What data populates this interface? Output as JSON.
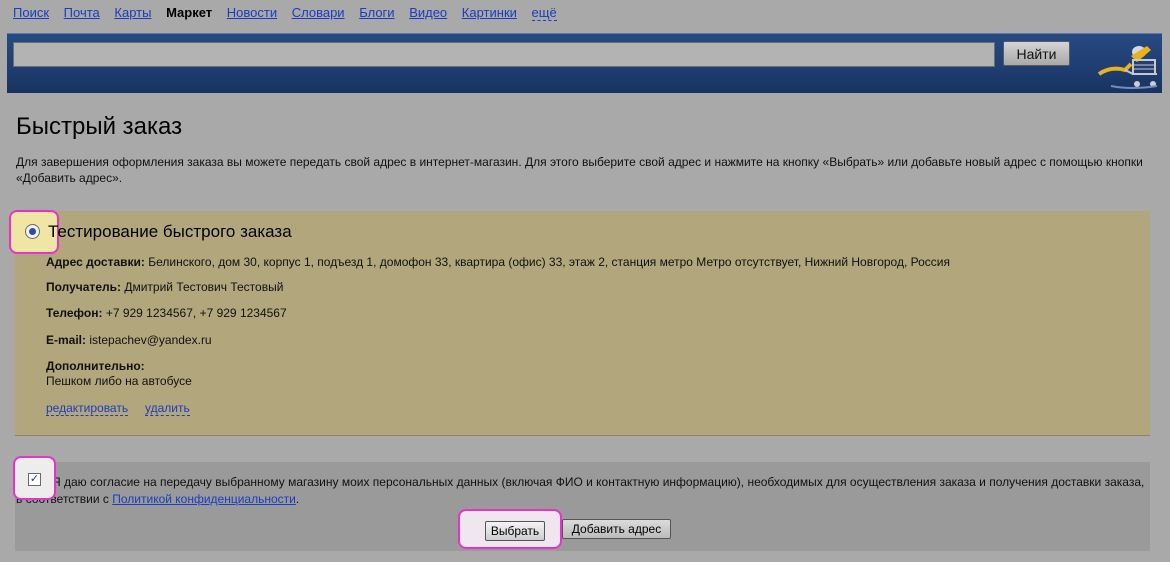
{
  "nav": {
    "items": [
      "Поиск",
      "Почта",
      "Карты",
      "Маркет",
      "Новости",
      "Словари",
      "Блоги",
      "Видео",
      "Картинки",
      "ещё"
    ],
    "active": "Маркет"
  },
  "search": {
    "value": "",
    "button_label": "Найти"
  },
  "page": {
    "title": "Быстрый заказ",
    "intro": "Для завершения оформления заказа вы можете передать свой адрес в интернет-магазин. Для этого выберите свой адрес и нажмите на кнопку «Выбрать» или добавьте новый адрес с помощью кнопки «Добавить адрес»."
  },
  "address": {
    "selected": true,
    "title": "Тестирование быстрого заказа",
    "delivery_label": "Адрес доставки:",
    "delivery_value": "Белинского, дом 30, корпус 1, подъезд 1, домофон 33, квартира (офис) 33, этаж 2, станция метро Метро отсутствует, Нижний Новгород, Россия",
    "recipient_label": "Получатель:",
    "recipient_value": "Дмитрий Тестович Тестовый",
    "phone_label": "Телефон:",
    "phone_value": "+7 929 1234567, +7 929 1234567",
    "email_label": "E-mail:",
    "email_value": "istepachev@yandex.ru",
    "extra_label": "Дополнительно:",
    "extra_value": "Пешком либо на автобусе",
    "edit_link": "редактировать",
    "delete_link": "удалить"
  },
  "consent": {
    "checked": true,
    "text": "Я даю согласие на передачу выбранному магазину моих персональных данных (включая ФИО и контактную информацию), необходимых для осуществления заказа и получения доставки заказа, в соответствии с ",
    "policy_link": "Политикой конфиденциальности",
    "suffix": "."
  },
  "actions": {
    "choose_label": "Выбрать",
    "add_label": "Добавить адрес"
  },
  "colors": {
    "card_bg": "#b2a77c",
    "highlight": "#e633c9",
    "link": "#1a3dc1",
    "header": "#1f3e72"
  }
}
